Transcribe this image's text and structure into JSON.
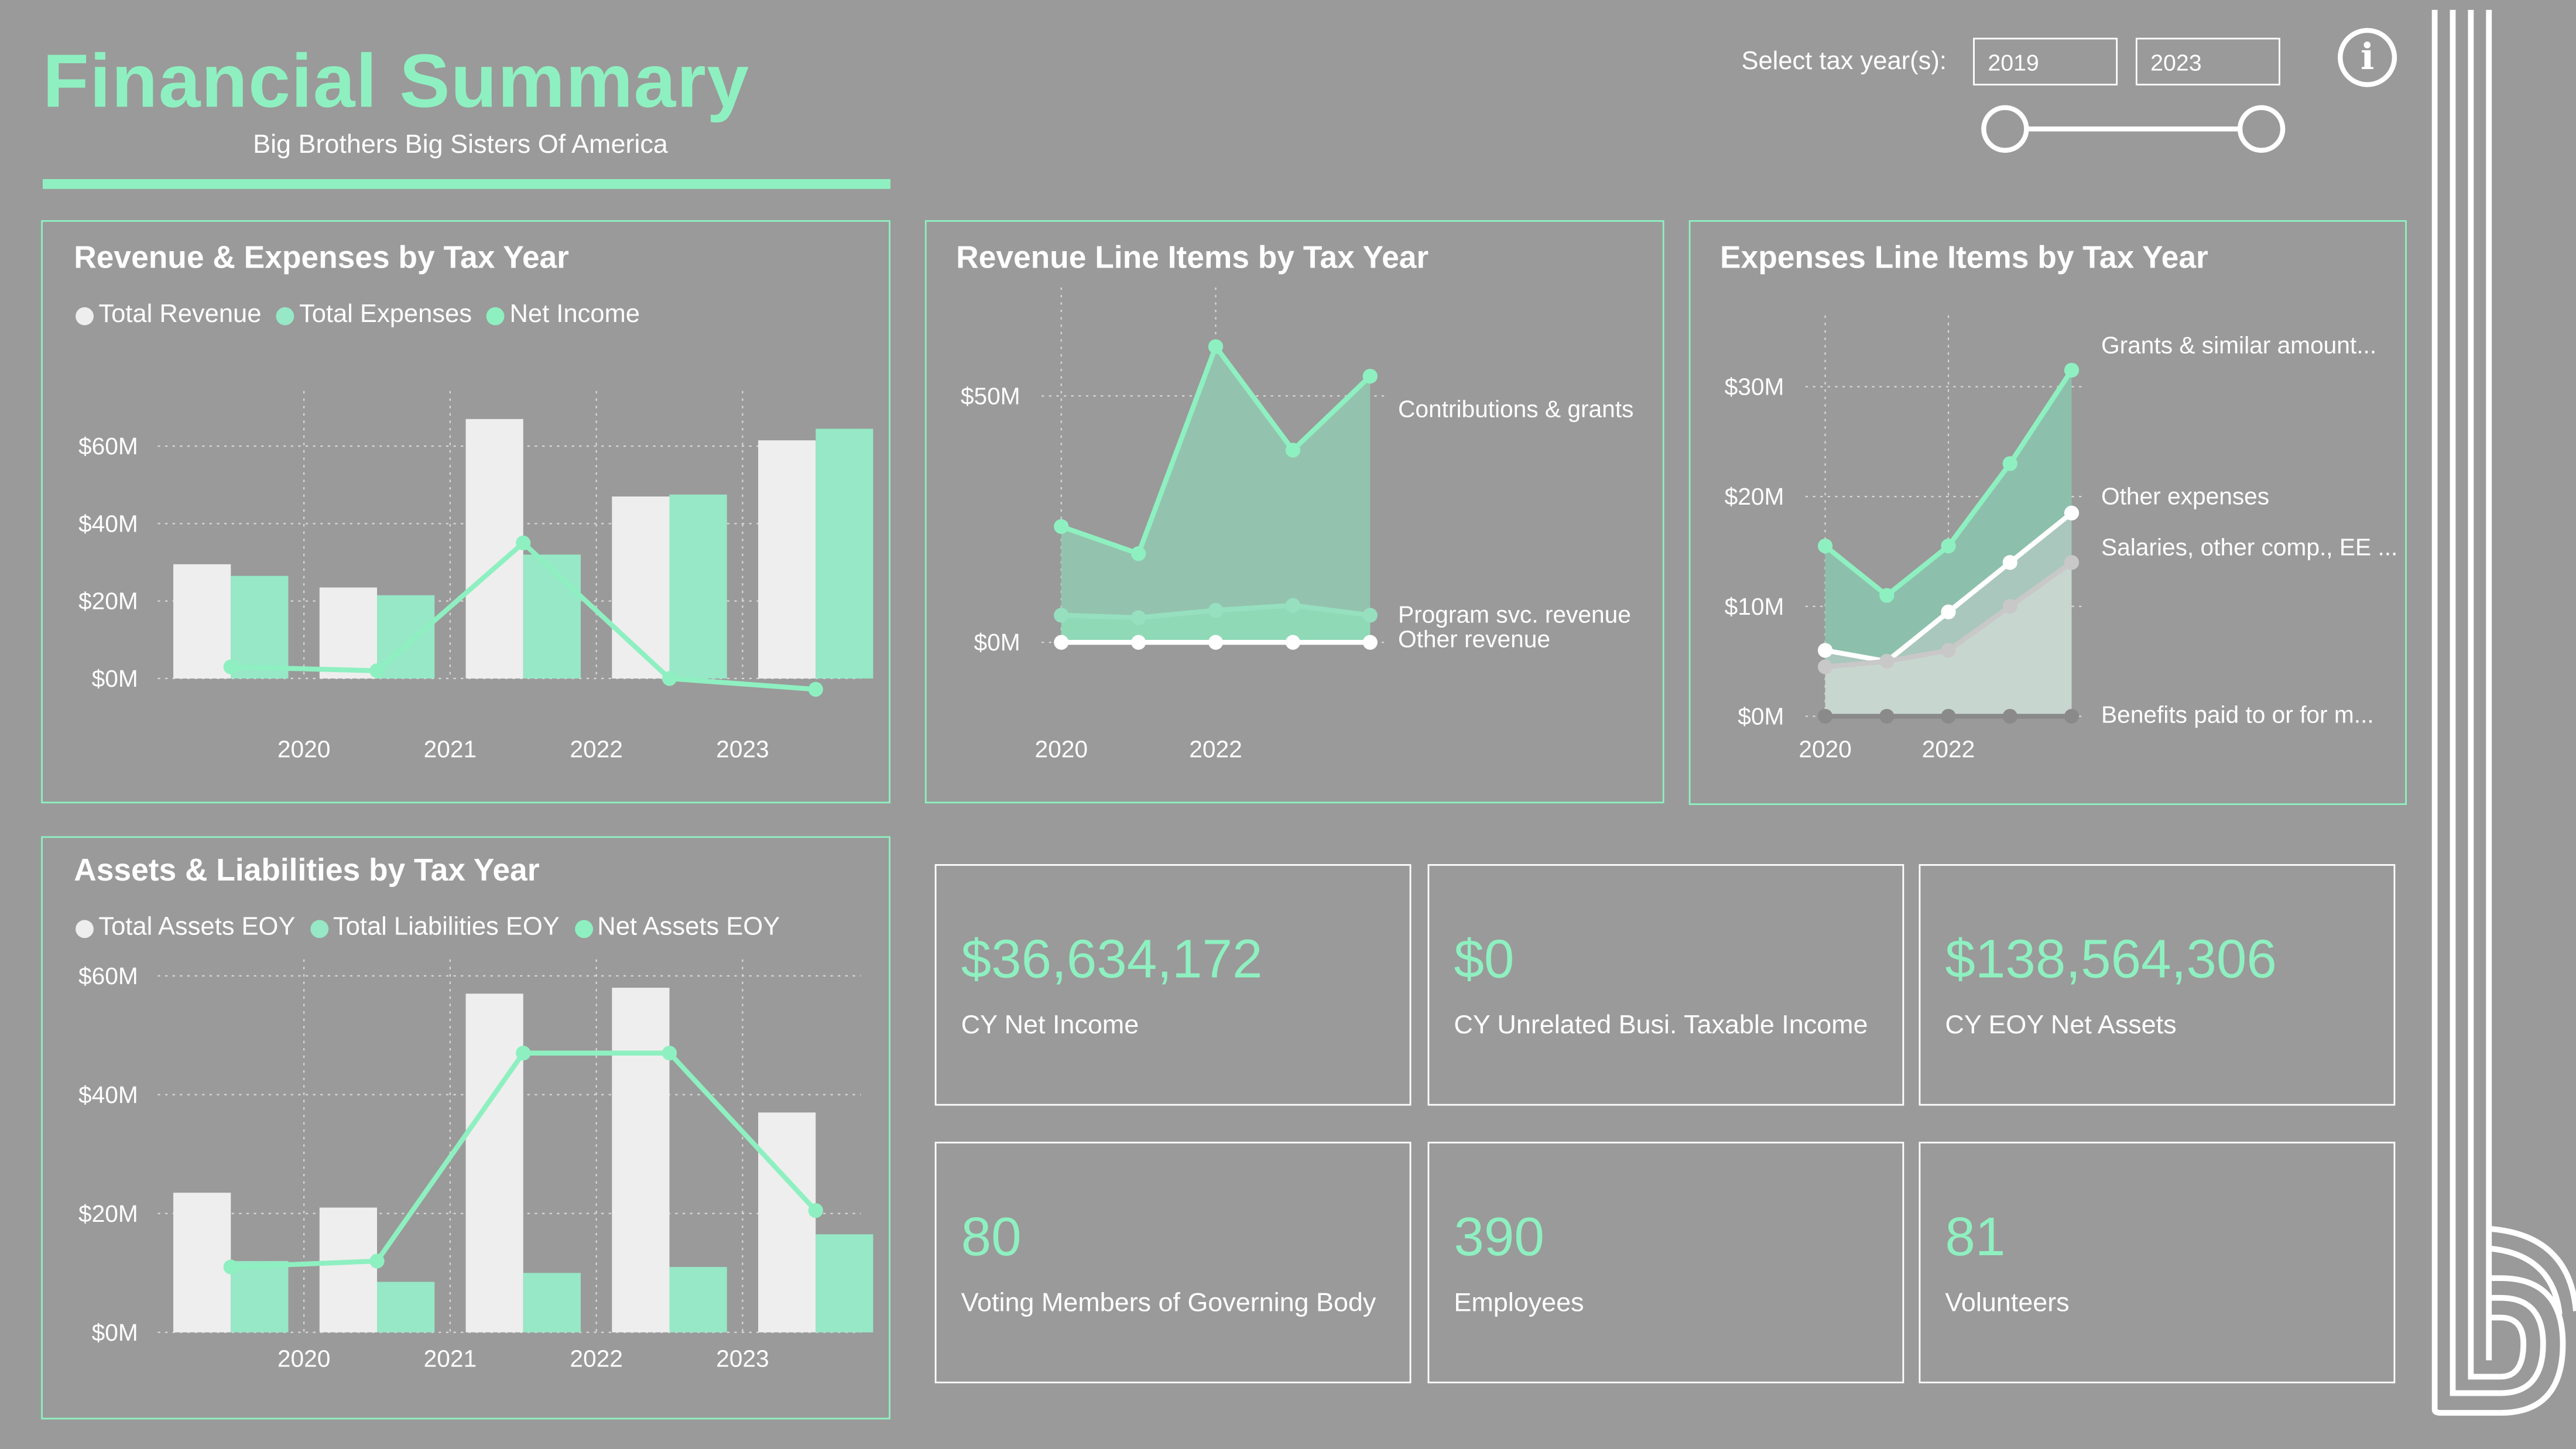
{
  "header": {
    "title": "Financial Summary",
    "subtitle": "Big Brothers Big Sisters Of America",
    "accent_color": "#8ef0c0"
  },
  "slicer": {
    "label": "Select tax year(s):",
    "from_value": "2019",
    "to_value": "2023",
    "range_fraction": [
      0,
      1
    ]
  },
  "info_icon": "info-icon",
  "colors": {
    "background": "#9a9a9a",
    "light_bar": "#eeeeee",
    "accent_bar": "#96e8c6",
    "line": "#8ef0c0"
  },
  "revenue_expenses": {
    "title": "Revenue & Expenses by Tax Year",
    "chart_data": {
      "type": "bar",
      "categories": [
        "2019",
        "2020",
        "2021",
        "2022",
        "2023"
      ],
      "tick_labels": [
        "2020",
        "2021",
        "2022",
        "2023"
      ],
      "y_ticks": [
        "$60M",
        "$40M",
        "$20M",
        "$0M"
      ],
      "ylim": [
        0,
        70
      ],
      "series": [
        {
          "name": "Total Revenue",
          "color": "#eeeeee",
          "kind": "bar",
          "values": [
            29.5,
            23.5,
            67,
            47,
            61.5
          ]
        },
        {
          "name": "Total Expenses",
          "color": "#96e8c6",
          "kind": "bar",
          "values": [
            26.5,
            21.5,
            32,
            47.5,
            64.5
          ]
        },
        {
          "name": "Net Income",
          "color": "#8ef0c0",
          "kind": "line",
          "values": [
            3,
            2,
            35,
            0,
            -2.8
          ]
        }
      ],
      "grid": true,
      "legend_position": "top-left"
    }
  },
  "revenue_items": {
    "title": "Revenue Line Items by Tax Year",
    "chart_data": {
      "type": "area",
      "x": [
        "2019",
        "2020",
        "2021",
        "2022",
        "2023"
      ],
      "tick_labels": [
        "2020",
        "2022"
      ],
      "y_ticks": [
        "$50M",
        "$0M"
      ],
      "ylim": [
        0,
        62
      ],
      "series": [
        {
          "name": "Contributions & grants",
          "color": "#8ef0c0",
          "values": [
            23.5,
            18,
            60,
            39,
            54
          ]
        },
        {
          "name": "Program svc. revenue",
          "color": "#96e0bf",
          "values": [
            5.5,
            5,
            6.5,
            7.5,
            5.5
          ]
        },
        {
          "name": "Other revenue",
          "color": "#ffffff",
          "values": [
            0,
            0,
            0,
            0,
            0
          ]
        }
      ],
      "grid": true,
      "legend_position": "right"
    }
  },
  "expense_items": {
    "title": "Expenses Line Items by Tax Year",
    "chart_data": {
      "type": "area",
      "x": [
        "2019",
        "2020",
        "2021",
        "2022",
        "2023"
      ],
      "tick_labels": [
        "2020",
        "2022"
      ],
      "y_ticks": [
        "$30M",
        "$20M",
        "$10M",
        "$0M"
      ],
      "ylim": [
        0,
        32
      ],
      "series": [
        {
          "name": "Grants & similar amount...",
          "color": "#8ef0c0",
          "values": [
            15.5,
            11,
            15.5,
            23,
            31.5
          ]
        },
        {
          "name": "Other expenses",
          "color": "#ffffff",
          "values": [
            6,
            5,
            9.5,
            14,
            18.5
          ]
        },
        {
          "name": "Salaries, other comp., EE ...",
          "color": "#c8c8c8",
          "values": [
            4.5,
            5,
            6,
            10,
            14
          ]
        },
        {
          "name": "Benefits paid to or for m...",
          "color": "#8a8a8a",
          "values": [
            0,
            0,
            0,
            0,
            0
          ]
        }
      ],
      "grid": true,
      "legend_position": "right"
    }
  },
  "assets_liabilities": {
    "title": "Assets & Liabilities by Tax Year",
    "chart_data": {
      "type": "bar",
      "categories": [
        "2019",
        "2020",
        "2021",
        "2022",
        "2023"
      ],
      "tick_labels": [
        "2020",
        "2021",
        "2022",
        "2023"
      ],
      "y_ticks": [
        "$60M",
        "$40M",
        "$20M",
        "$0M"
      ],
      "ylim": [
        0,
        60
      ],
      "series": [
        {
          "name": "Total Assets EOY",
          "color": "#eeeeee",
          "kind": "bar",
          "values": [
            23.5,
            21,
            57,
            58,
            37
          ]
        },
        {
          "name": "Total Liabilities EOY",
          "color": "#96e8c6",
          "kind": "bar",
          "values": [
            12,
            8.5,
            10,
            11,
            16.5
          ]
        },
        {
          "name": "Net Assets EOY",
          "color": "#8ef0c0",
          "kind": "line",
          "values": [
            11,
            12,
            47,
            47,
            20.5
          ]
        }
      ],
      "grid": true,
      "legend_position": "top-left"
    }
  },
  "kpis": [
    {
      "value": "$36,634,172",
      "label": "CY Net Income"
    },
    {
      "value": "$0",
      "label": "CY Unrelated Busi. Taxable Income"
    },
    {
      "value": "$138,564,306",
      "label": "CY EOY Net Assets"
    },
    {
      "value": "80",
      "label": "Voting Members of Governing Body"
    },
    {
      "value": "390",
      "label": "Employees"
    },
    {
      "value": "81",
      "label": "Volunteers"
    }
  ],
  "logo": "big-brothers-big-sisters-logo"
}
